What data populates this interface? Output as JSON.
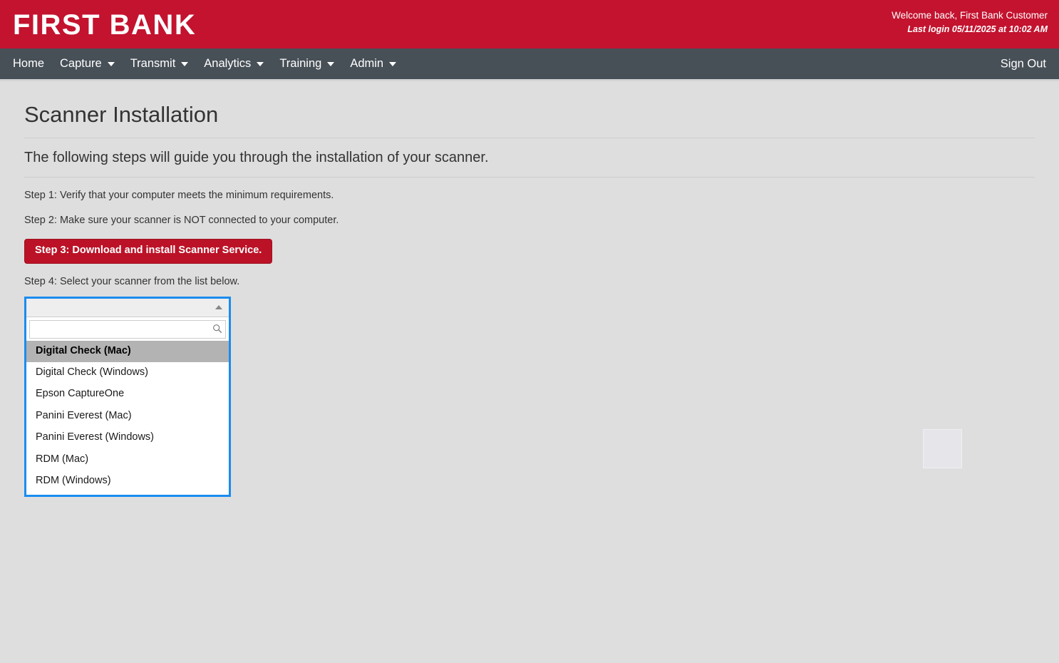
{
  "brand": {
    "logo_text": "FIRST BANK",
    "brand_color": "#c3132f",
    "welcome_text": "Welcome back, First Bank Customer",
    "last_login_text": "Last login 05/11/2025 at 10:02 AM"
  },
  "nav": {
    "background_color": "#474f57",
    "items": [
      {
        "label": "Home",
        "has_caret": false
      },
      {
        "label": "Capture",
        "has_caret": true
      },
      {
        "label": "Transmit",
        "has_caret": true
      },
      {
        "label": "Analytics",
        "has_caret": true
      },
      {
        "label": "Training",
        "has_caret": true
      },
      {
        "label": "Admin",
        "has_caret": true
      }
    ],
    "sign_out_label": "Sign Out"
  },
  "page": {
    "title": "Scanner Installation",
    "subtitle": "The following steps will guide you through the installation of your scanner.",
    "step1": "Step 1: Verify that your computer meets the minimum requirements.",
    "step2": "Step 2: Make sure your scanner is NOT connected to your computer.",
    "step3_button": "Step 3: Download and install Scanner Service.",
    "step3_button_color": "#bb1227",
    "step4": "Step 4: Select your scanner from the list below."
  },
  "scanner_select": {
    "selected_value": "",
    "search_value": "",
    "search_placeholder": "",
    "search_icon": "search-icon",
    "toggle_icon": "chevron-up-icon",
    "focus_border_color": "#1a8cf0",
    "highlight_color": "#b3b3b3",
    "options": [
      {
        "label": "Digital Check (Mac)",
        "highlighted": true
      },
      {
        "label": "Digital Check (Windows)",
        "highlighted": false
      },
      {
        "label": "Epson CaptureOne",
        "highlighted": false
      },
      {
        "label": "Panini Everest (Mac)",
        "highlighted": false
      },
      {
        "label": "Panini Everest (Windows)",
        "highlighted": false
      },
      {
        "label": "RDM (Mac)",
        "highlighted": false
      },
      {
        "label": "RDM (Windows)",
        "highlighted": false
      }
    ]
  }
}
